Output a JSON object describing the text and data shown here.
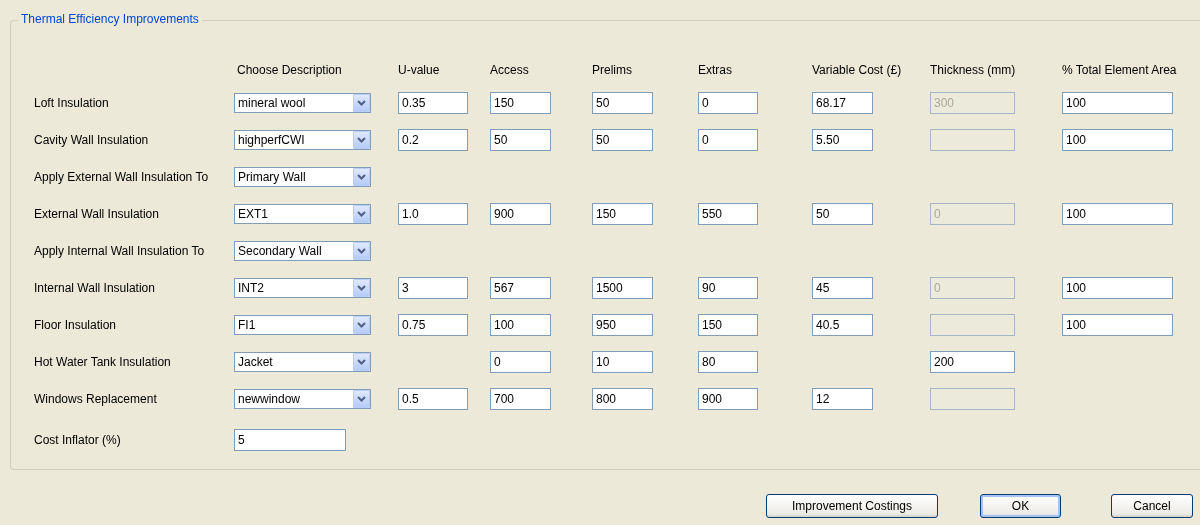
{
  "group": {
    "title": "Thermal Efficiency Improvements"
  },
  "columns": [
    "Choose Description",
    "U-value",
    "Access",
    "Prelims",
    "Extras",
    "Variable Cost (£)",
    "Thickness (mm)",
    "% Total Element Area"
  ],
  "rows": [
    {
      "kind": "measure",
      "label": "Loft Insulation",
      "choice": "mineral wool",
      "u_value": {
        "value": "0.35"
      },
      "access": {
        "value": "150"
      },
      "prelims": {
        "value": "50"
      },
      "extras": {
        "value": "0"
      },
      "variable_cost": {
        "value": "68.17"
      },
      "thickness": {
        "value": "300",
        "disabled": true
      },
      "total_area": {
        "value": "100"
      }
    },
    {
      "kind": "measure",
      "label": "Cavity Wall Insulation",
      "choice": "highperfCWI",
      "u_value": {
        "value": "0.2"
      },
      "access": {
        "value": "50"
      },
      "prelims": {
        "value": "50"
      },
      "extras": {
        "value": "0"
      },
      "variable_cost": {
        "value": "5.50"
      },
      "thickness": {
        "disabled": true
      },
      "total_area": {
        "value": "100"
      }
    },
    {
      "kind": "apply",
      "label": "Apply External Wall Insulation To",
      "choice": "Primary Wall"
    },
    {
      "kind": "measure",
      "label": "External Wall Insulation",
      "choice": "EXT1",
      "u_value": {
        "value": "1.0"
      },
      "access": {
        "value": "900"
      },
      "prelims": {
        "value": "150"
      },
      "extras": {
        "value": "550"
      },
      "variable_cost": {
        "value": "50"
      },
      "thickness": {
        "value": "0",
        "disabled": true
      },
      "total_area": {
        "value": "100"
      }
    },
    {
      "kind": "apply",
      "label": "Apply Internal Wall Insulation To",
      "choice": "Secondary Wall"
    },
    {
      "kind": "measure",
      "label": "Internal Wall Insulation",
      "choice": "INT2",
      "u_value": {
        "value": "3"
      },
      "access": {
        "value": "567"
      },
      "prelims": {
        "value": "1500"
      },
      "extras": {
        "value": "90"
      },
      "variable_cost": {
        "value": "45"
      },
      "thickness": {
        "value": "0",
        "disabled": true
      },
      "total_area": {
        "value": "100"
      }
    },
    {
      "kind": "measure",
      "label": "Floor Insulation",
      "choice": "FI1",
      "u_value": {
        "value": "0.75"
      },
      "access": {
        "value": "100"
      },
      "prelims": {
        "value": "950"
      },
      "extras": {
        "value": "150"
      },
      "variable_cost": {
        "value": "40.5"
      },
      "thickness": {
        "disabled": true
      },
      "total_area": {
        "value": "100"
      }
    },
    {
      "kind": "measure",
      "label": "Hot Water Tank Insulation",
      "choice": "Jacket",
      "access": {
        "value": "0"
      },
      "prelims": {
        "value": "10"
      },
      "extras": {
        "value": "80"
      },
      "thickness": {
        "value": "200"
      }
    },
    {
      "kind": "measure",
      "label": "Windows Replacement",
      "choice": "newwindow",
      "u_value": {
        "value": "0.5"
      },
      "access": {
        "value": "700"
      },
      "prelims": {
        "value": "800"
      },
      "extras": {
        "value": "900"
      },
      "variable_cost": {
        "value": "12"
      },
      "thickness": {
        "disabled": true
      }
    },
    {
      "kind": "inflator",
      "label": "Cost Inflator (%)",
      "value": "5"
    }
  ],
  "buttons": [
    {
      "label": "Improvement Costings",
      "default": false
    },
    {
      "label": "OK",
      "default": true
    },
    {
      "label": "Cancel",
      "default": false
    }
  ]
}
